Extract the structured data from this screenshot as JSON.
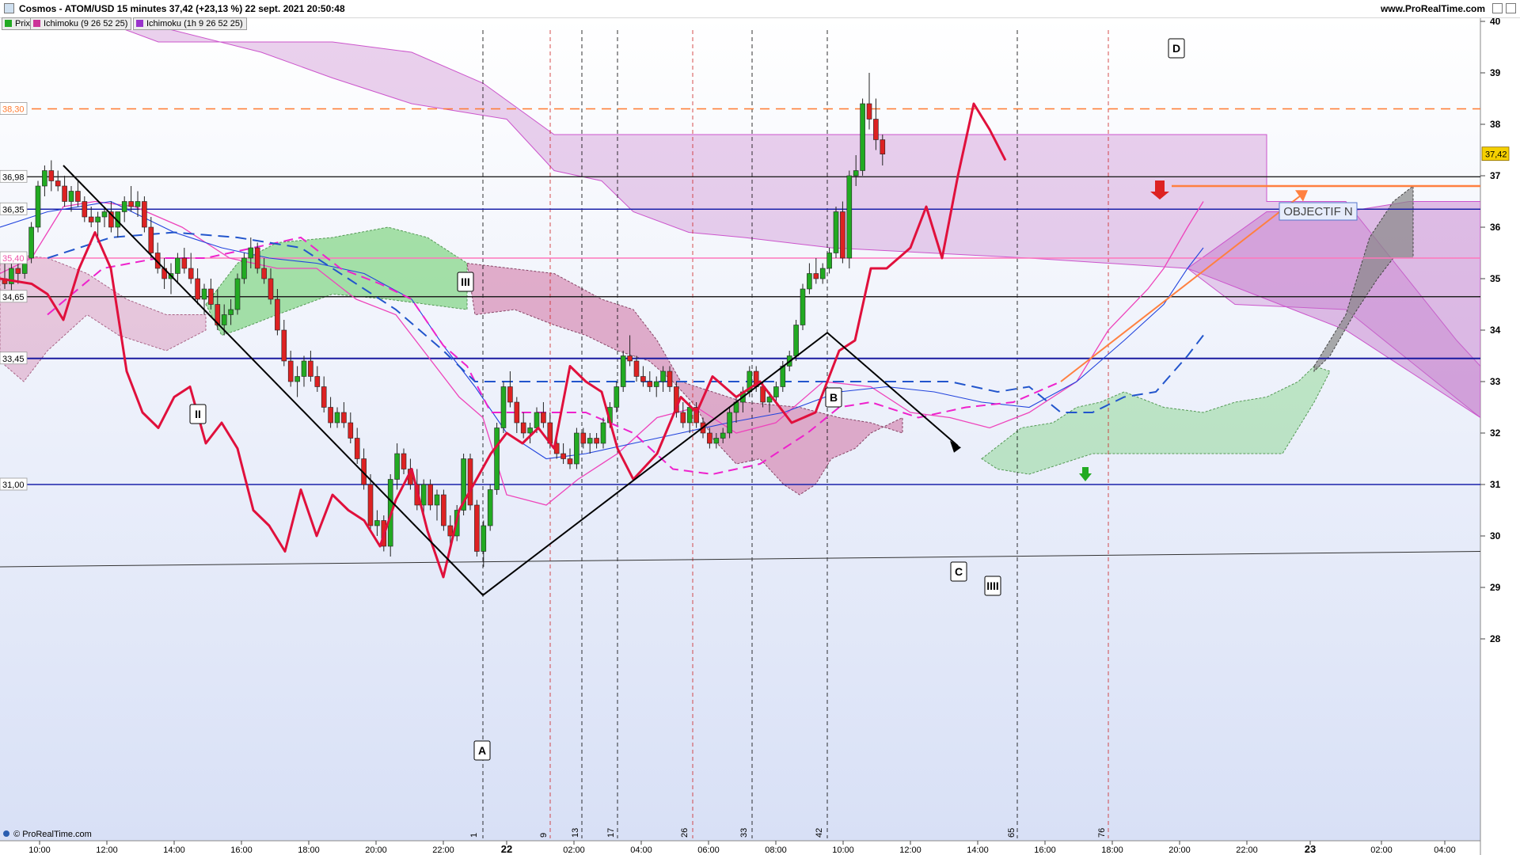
{
  "window": {
    "title": "Cosmos - ATOM/USD 15 minutes 37,42 (+23,13 %) 22 sept. 2021 20:50:48",
    "website": "www.ProRealTime.com",
    "footer": "© ProRealTime.com"
  },
  "legend": [
    {
      "label": "Prix",
      "color": "#22aa22"
    },
    {
      "label": "Ichimoku (9 26 52 25)",
      "color": "#cc3399"
    },
    {
      "label": "Ichimoku (1h 9 26 52 25)",
      "color": "#9933cc"
    }
  ],
  "colors": {
    "up_candle": "#22aa22",
    "down_candle": "#dd2222",
    "kumo_purple": "#c070c8",
    "kumo_green": "#60cc60",
    "kumo_pink": "#d070a0",
    "chikou": "#e0103c",
    "kijun_dashed": "#2255cc",
    "target_orange": "#ff8040"
  },
  "chart_data": {
    "type": "candlestick",
    "instrument": "ATOM/USD",
    "timeframe": "15 minutes",
    "last_price": "37,42",
    "y_axis": {
      "range": [
        27.2,
        40.2
      ],
      "ticks": [
        "28",
        "29",
        "30",
        "31",
        "32",
        "33",
        "34",
        "35",
        "36",
        "37",
        "38",
        "39",
        "40"
      ]
    },
    "x_axis": {
      "ticks": [
        "10:00",
        "12:00",
        "14:00",
        "16:00",
        "18:00",
        "20:00",
        "22:00",
        "22",
        "02:00",
        "04:00",
        "06:00",
        "08:00",
        "10:00",
        "12:00",
        "14:00",
        "16:00",
        "18:00",
        "20:00",
        "22:00",
        "23",
        "02:00",
        "04:00"
      ]
    },
    "price_levels": [
      {
        "value": 38.3,
        "label": "38,30",
        "color": "#ff7a30",
        "style": "dashed"
      },
      {
        "value": 36.98,
        "label": "36,98",
        "color": "#222222",
        "style": "solid"
      },
      {
        "value": 36.35,
        "label": "36,35",
        "color": "#1a22aa",
        "style": "solid"
      },
      {
        "value": 35.4,
        "label": "35,40",
        "color": "#ff77bb",
        "style": "solid"
      },
      {
        "value": 34.65,
        "label": "34,65",
        "color": "#222222",
        "style": "solid"
      },
      {
        "value": 33.45,
        "label": "33,45",
        "color": "#1a1aa0",
        "style": "solid"
      },
      {
        "value": 31.0,
        "label": "31,00",
        "color": "#1a22aa",
        "style": "solid"
      }
    ],
    "wave_labels": [
      {
        "label": "A",
        "price": 28.85
      },
      {
        "label": "B",
        "price": 33.95
      },
      {
        "label": "C",
        "price": 31.75
      },
      {
        "label": "D",
        "price": 39.1
      }
    ],
    "ichimoku_labels": [
      "II",
      "III",
      "IIII"
    ],
    "annotation": "OBJECTIF N",
    "bar_counts": [
      "1",
      "9",
      "13",
      "17",
      "26",
      "33",
      "42",
      "65",
      "76"
    ],
    "candles": [
      [
        35.0,
        35.3,
        34.8,
        34.9
      ],
      [
        34.9,
        35.3,
        34.7,
        35.2
      ],
      [
        35.2,
        35.4,
        34.9,
        35.1
      ],
      [
        35.1,
        35.5,
        35.0,
        35.4
      ],
      [
        35.4,
        36.1,
        35.3,
        36.0
      ],
      [
        36.0,
        36.9,
        35.9,
        36.8
      ],
      [
        36.8,
        37.2,
        36.6,
        37.1
      ],
      [
        37.1,
        37.3,
        36.7,
        36.9
      ],
      [
        36.9,
        37.1,
        36.7,
        36.8
      ],
      [
        36.8,
        37.0,
        36.4,
        36.5
      ],
      [
        36.5,
        36.8,
        36.3,
        36.7
      ],
      [
        36.7,
        36.9,
        36.4,
        36.5
      ],
      [
        36.5,
        36.6,
        36.1,
        36.2
      ],
      [
        36.2,
        36.4,
        36.0,
        36.1
      ],
      [
        36.1,
        36.3,
        35.8,
        36.2
      ],
      [
        36.2,
        36.4,
        36.0,
        36.3
      ],
      [
        36.3,
        36.5,
        35.9,
        36.0
      ],
      [
        36.0,
        36.3,
        35.8,
        36.3
      ],
      [
        36.3,
        36.6,
        36.1,
        36.5
      ],
      [
        36.5,
        36.8,
        36.3,
        36.4
      ],
      [
        36.4,
        36.7,
        36.2,
        36.5
      ],
      [
        36.5,
        36.6,
        35.9,
        36.0
      ],
      [
        36.0,
        36.2,
        35.4,
        35.5
      ],
      [
        35.5,
        35.7,
        35.1,
        35.2
      ],
      [
        35.2,
        35.4,
        34.8,
        35.0
      ],
      [
        35.0,
        35.3,
        34.7,
        35.1
      ],
      [
        35.1,
        35.5,
        34.9,
        35.4
      ],
      [
        35.4,
        35.6,
        35.1,
        35.2
      ],
      [
        35.2,
        35.5,
        34.9,
        35.0
      ],
      [
        35.0,
        35.2,
        34.5,
        34.6
      ],
      [
        34.6,
        34.9,
        34.3,
        34.8
      ],
      [
        34.8,
        35.0,
        34.4,
        34.5
      ],
      [
        34.5,
        34.8,
        34.0,
        34.1
      ],
      [
        34.1,
        34.5,
        33.9,
        34.3
      ],
      [
        34.3,
        34.6,
        34.1,
        34.4
      ],
      [
        34.4,
        35.1,
        34.3,
        35.0
      ],
      [
        35.0,
        35.5,
        34.9,
        35.4
      ],
      [
        35.4,
        35.8,
        35.2,
        35.6
      ],
      [
        35.6,
        35.7,
        35.1,
        35.2
      ],
      [
        35.2,
        35.4,
        34.9,
        35.0
      ],
      [
        35.0,
        35.2,
        34.5,
        34.6
      ],
      [
        34.6,
        34.8,
        33.9,
        34.0
      ],
      [
        34.0,
        34.2,
        33.3,
        33.4
      ],
      [
        33.4,
        33.6,
        32.9,
        33.0
      ],
      [
        33.0,
        33.3,
        32.7,
        33.1
      ],
      [
        33.1,
        33.5,
        32.9,
        33.4
      ],
      [
        33.4,
        33.6,
        33.0,
        33.1
      ],
      [
        33.1,
        33.3,
        32.8,
        32.9
      ],
      [
        32.9,
        33.1,
        32.4,
        32.5
      ],
      [
        32.5,
        32.7,
        32.1,
        32.2
      ],
      [
        32.2,
        32.5,
        32.1,
        32.4
      ],
      [
        32.4,
        32.6,
        32.1,
        32.2
      ],
      [
        32.2,
        32.4,
        31.8,
        31.9
      ],
      [
        31.9,
        32.1,
        31.4,
        31.5
      ],
      [
        31.5,
        31.7,
        30.9,
        31.0
      ],
      [
        31.0,
        31.2,
        30.1,
        30.2
      ],
      [
        30.2,
        30.5,
        30.0,
        30.3
      ],
      [
        30.3,
        30.4,
        29.7,
        29.8
      ],
      [
        29.8,
        31.2,
        29.6,
        31.1
      ],
      [
        31.1,
        31.8,
        30.9,
        31.6
      ],
      [
        31.6,
        31.7,
        31.2,
        31.3
      ],
      [
        31.3,
        31.5,
        30.9,
        31.0
      ],
      [
        31.0,
        31.3,
        30.5,
        30.6
      ],
      [
        30.6,
        31.1,
        30.4,
        31.0
      ],
      [
        31.0,
        31.1,
        30.5,
        30.6
      ],
      [
        30.6,
        30.9,
        30.3,
        30.8
      ],
      [
        30.8,
        30.9,
        30.1,
        30.2
      ],
      [
        30.2,
        30.4,
        29.8,
        30.0
      ],
      [
        30.0,
        30.6,
        29.9,
        30.5
      ],
      [
        30.5,
        31.6,
        30.4,
        31.5
      ],
      [
        31.5,
        31.6,
        30.5,
        30.6
      ],
      [
        30.6,
        30.7,
        29.6,
        29.7
      ],
      [
        29.7,
        30.3,
        29.4,
        30.2
      ],
      [
        30.2,
        31.0,
        30.1,
        30.9
      ],
      [
        30.9,
        32.2,
        30.8,
        32.1
      ],
      [
        32.1,
        33.0,
        32.0,
        32.9
      ],
      [
        32.9,
        33.2,
        32.5,
        32.6
      ],
      [
        32.6,
        32.7,
        32.0,
        32.2
      ],
      [
        32.2,
        32.4,
        31.9,
        32.0
      ],
      [
        32.0,
        32.2,
        31.8,
        32.1
      ],
      [
        32.1,
        32.5,
        32.0,
        32.4
      ],
      [
        32.4,
        32.6,
        32.1,
        32.2
      ],
      [
        32.2,
        32.4,
        31.7,
        31.8
      ],
      [
        31.8,
        32.0,
        31.5,
        31.6
      ],
      [
        31.6,
        31.8,
        31.4,
        31.5
      ],
      [
        31.5,
        31.7,
        31.3,
        31.4
      ],
      [
        31.4,
        32.1,
        31.3,
        32.0
      ],
      [
        32.0,
        32.1,
        31.7,
        31.8
      ],
      [
        31.8,
        32.0,
        31.6,
        31.9
      ],
      [
        31.9,
        32.0,
        31.7,
        31.8
      ],
      [
        31.8,
        32.3,
        31.7,
        32.2
      ],
      [
        32.2,
        32.6,
        32.1,
        32.5
      ],
      [
        32.5,
        33.0,
        32.4,
        32.9
      ],
      [
        32.9,
        33.6,
        32.8,
        33.5
      ],
      [
        33.5,
        33.9,
        33.3,
        33.4
      ],
      [
        33.4,
        33.5,
        33.0,
        33.1
      ],
      [
        33.1,
        33.3,
        32.9,
        33.0
      ],
      [
        33.0,
        33.2,
        32.8,
        32.9
      ],
      [
        32.9,
        33.1,
        32.7,
        33.0
      ],
      [
        33.0,
        33.3,
        32.8,
        33.2
      ],
      [
        33.2,
        33.3,
        32.8,
        32.9
      ],
      [
        32.9,
        33.0,
        32.3,
        32.4
      ],
      [
        32.4,
        32.6,
        32.1,
        32.2
      ],
      [
        32.2,
        32.6,
        32.0,
        32.5
      ],
      [
        32.5,
        32.6,
        32.1,
        32.2
      ],
      [
        32.2,
        32.3,
        31.9,
        32.0
      ],
      [
        32.0,
        32.1,
        31.7,
        31.8
      ],
      [
        31.8,
        32.0,
        31.7,
        31.9
      ],
      [
        31.9,
        32.1,
        31.8,
        32.0
      ],
      [
        32.0,
        32.5,
        31.9,
        32.4
      ],
      [
        32.4,
        32.7,
        32.2,
        32.6
      ],
      [
        32.6,
        32.9,
        32.4,
        32.8
      ],
      [
        32.8,
        33.3,
        32.7,
        33.2
      ],
      [
        33.2,
        33.3,
        32.8,
        32.9
      ],
      [
        32.9,
        33.0,
        32.5,
        32.6
      ],
      [
        32.6,
        32.8,
        32.4,
        32.7
      ],
      [
        32.7,
        33.0,
        32.6,
        32.9
      ],
      [
        32.9,
        33.4,
        32.8,
        33.3
      ],
      [
        33.3,
        33.6,
        33.2,
        33.5
      ],
      [
        33.5,
        34.2,
        33.4,
        34.1
      ],
      [
        34.1,
        34.9,
        34.0,
        34.8
      ],
      [
        34.8,
        35.3,
        34.7,
        35.1
      ],
      [
        35.1,
        35.4,
        34.9,
        35.0
      ],
      [
        35.0,
        35.3,
        34.9,
        35.2
      ],
      [
        35.2,
        35.6,
        35.1,
        35.5
      ],
      [
        35.5,
        36.4,
        35.4,
        36.3
      ],
      [
        36.3,
        36.5,
        35.3,
        35.4
      ],
      [
        35.4,
        37.1,
        35.2,
        37.0
      ],
      [
        37.0,
        37.4,
        36.8,
        37.1
      ],
      [
        37.1,
        38.5,
        37.0,
        38.4
      ],
      [
        38.4,
        39.0,
        37.9,
        38.1
      ],
      [
        38.1,
        38.5,
        37.5,
        37.7
      ],
      [
        37.7,
        37.8,
        37.2,
        37.42
      ]
    ]
  }
}
